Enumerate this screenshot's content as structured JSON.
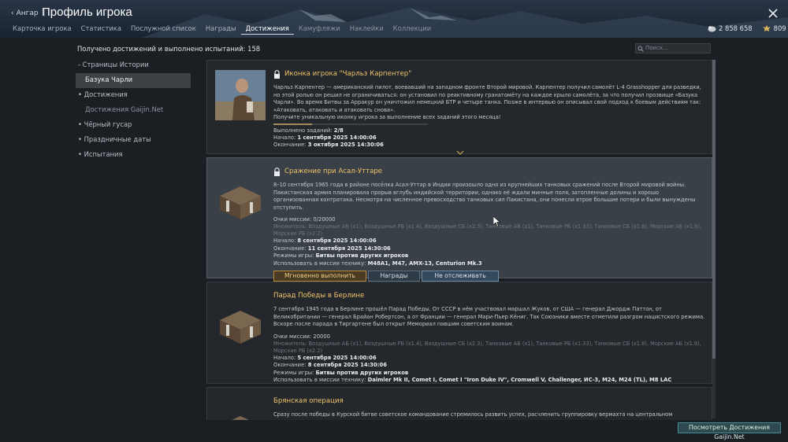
{
  "header": {
    "back_label": "Ангар",
    "title": "Профиль игрока",
    "tabs": [
      {
        "label": "Карточка игрока"
      },
      {
        "label": "Статистика"
      },
      {
        "label": "Послужной список"
      },
      {
        "label": "Награды"
      },
      {
        "label": "Достижения"
      },
      {
        "label": "Камуфляжи"
      },
      {
        "label": "Наклейки"
      },
      {
        "label": "Коллекции"
      }
    ],
    "active_tab": "Достижения",
    "silver_lions": "2 858 658",
    "golden_eagles": "809"
  },
  "summary": {
    "text": "Получено достижений и выполнено испытаний: 158",
    "search_placeholder": "Поиск..."
  },
  "sidebar": {
    "items": [
      {
        "label": "- Страницы Истории"
      },
      {
        "label": "Базука Чарли"
      },
      {
        "label": "• Достижения"
      },
      {
        "label": "Достижения Gaijin.Net"
      },
      {
        "label": "• Чёрный гусар"
      },
      {
        "label": "• Праздничные даты"
      },
      {
        "label": "• Испытания"
      }
    ]
  },
  "cards": [
    {
      "title": "Иконка игрока \"Чарльз Карпентер\"",
      "description": "Чарльз Карпентер — американский пилот, воевавший на западном фронте Второй мировой. Карпентер получил самолёт L-4 Grasshopper для разведки, но этой ролью он решил не ограничиваться: он установил по реактивному гранатомёту на каждое крыло самолёта, за что получил прозвище «Базука Чарли». Во время Битвы за Арракур он уничтожил немецкий БТР и четыре танка. Позже в интервью он описывал свой подход к боевым действиям так: «Атаковать, атаковать и атаковать снова».",
      "reward_text": "Получите уникальную иконку игрока за выполнение всех заданий этого месяца!",
      "progress": 0.25,
      "tasks_label": "Выполнено заданий:",
      "tasks_value": "2/8",
      "start_label": "Начало:",
      "start_value": "1 сентября 2025 14:00:06",
      "end_label": "Окончание:",
      "end_value": "3 октября 2025 14:30:06"
    },
    {
      "title": "Сражение при Асал-Уттаре",
      "description": "8–10 сентября 1965 года в районе посёлка Асал-Уттар в Индии произошло одно из крупнейших танковых сражений после Второй мировой войны. Пакистанская армия планировала прорыв вглубь индийской территории, однако её ждали минные поля, затопленные долины и хорошо организованная контратака. Несмотря на численное превосходство танковых сил Пакистана, они понесли втрое большие потери и были вынуждены отступить.",
      "points_label": "Очки миссии:",
      "points_value": "0/20000",
      "multipliers": "Множитель: Воздушные АБ (x1), Воздушные РБ (x1.4), Воздушные СБ (x2.3), Танковые АБ (x1), Танковые РБ (x1.33), Танковые СБ (x1.8), Морские АБ (x1.9), Морские РБ (x2.2)",
      "start_label": "Начало:",
      "start_value": "8 сентября 2025 14:00:06",
      "end_label": "Окончание:",
      "end_value": "11 сентября 2025 14:30:06",
      "modes_label": "Режимы игры:",
      "modes_value": "Битвы против других игроков",
      "vehicles_label": "Использовать в миссии технику:",
      "vehicles_value": "M48A1, M47, AMX-13, Centurion Mk.3",
      "btn_instant": "Мгновенно выполнить (299",
      "btn_rewards": "Награды",
      "btn_untrack": "Не отслеживать прогресс"
    },
    {
      "title": "Парад Победы в Берлине",
      "description": "7 сентября 1945 года в Берлине прошёл Парад Победы. От СССР в нём участвовал маршал Жуков, от США — генерал Джордж Паттон, от Великобритании — генерал Брайан Робертсон, а от Франции — генерал Мари-Пьер Кёниг. Так Союзники вместе отметили разгром нацистского режима. Вскоре после парада в Тиргартене был открыт Мемориал павшим советским воинам.",
      "points_label": "Очки миссии:",
      "points_value": "20000",
      "multipliers": "Множитель: Воздушные АБ (x1), Воздушные РБ (x1.4), Воздушные СБ (x2.3), Танковые АБ (x1), Танковые РБ (x1.33), Танковые СБ (x1.8), Морские АБ (x1.9), Морские РБ (x2.2)",
      "start_label": "Начало:",
      "start_value": "5 сентября 2025 14:00:06",
      "end_label": "Окончание:",
      "end_value": "8 сентября 2025 14:30:06",
      "modes_label": "Режимы игры:",
      "modes_value": "Битвы против других игроков",
      "vehicles_label": "Использовать в миссии технику:",
      "vehicles_value": "Daimler Mk II, Comet I, Comet I \"Iron Duke IV\", Cromwell V, Challenger, ИС-3, M24, M24 (TL), M8 LAC"
    },
    {
      "title": "Брянская операция",
      "description": "Сразу после победы в Курской битве советское командование стремилось развить успех, расчленить группировку вермахта на центральном направлении и"
    }
  ],
  "footer": {
    "view_gaijin": "Посмотреть Достижения Gaijin.Net"
  }
}
